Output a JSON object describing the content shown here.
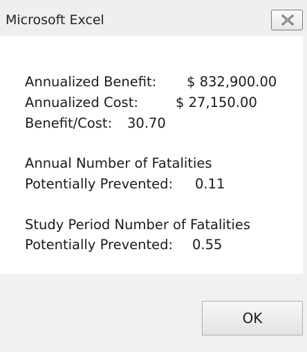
{
  "window": {
    "title": "Microsoft Excel",
    "close_icon": "close-x-icon"
  },
  "results": {
    "annualized_benefit_label": "Annualized Benefit:",
    "annualized_benefit_value": "$ 832,900.00",
    "annualized_cost_label": "Annualized Cost:",
    "annualized_cost_value": "$ 27,150.00",
    "benefit_cost_label": "Benefit/Cost:",
    "benefit_cost_value": "30.70",
    "annual_fatalities_heading": "Annual Number of Fatalities",
    "annual_fatalities_label": "Potentially Prevented:",
    "annual_fatalities_value": "0.11",
    "study_fatalities_heading": "Study Period Number of Fatalities",
    "study_fatalities_label": "Potentially Prevented:",
    "study_fatalities_value": "0.55"
  },
  "buttons": {
    "ok_label": "OK"
  }
}
